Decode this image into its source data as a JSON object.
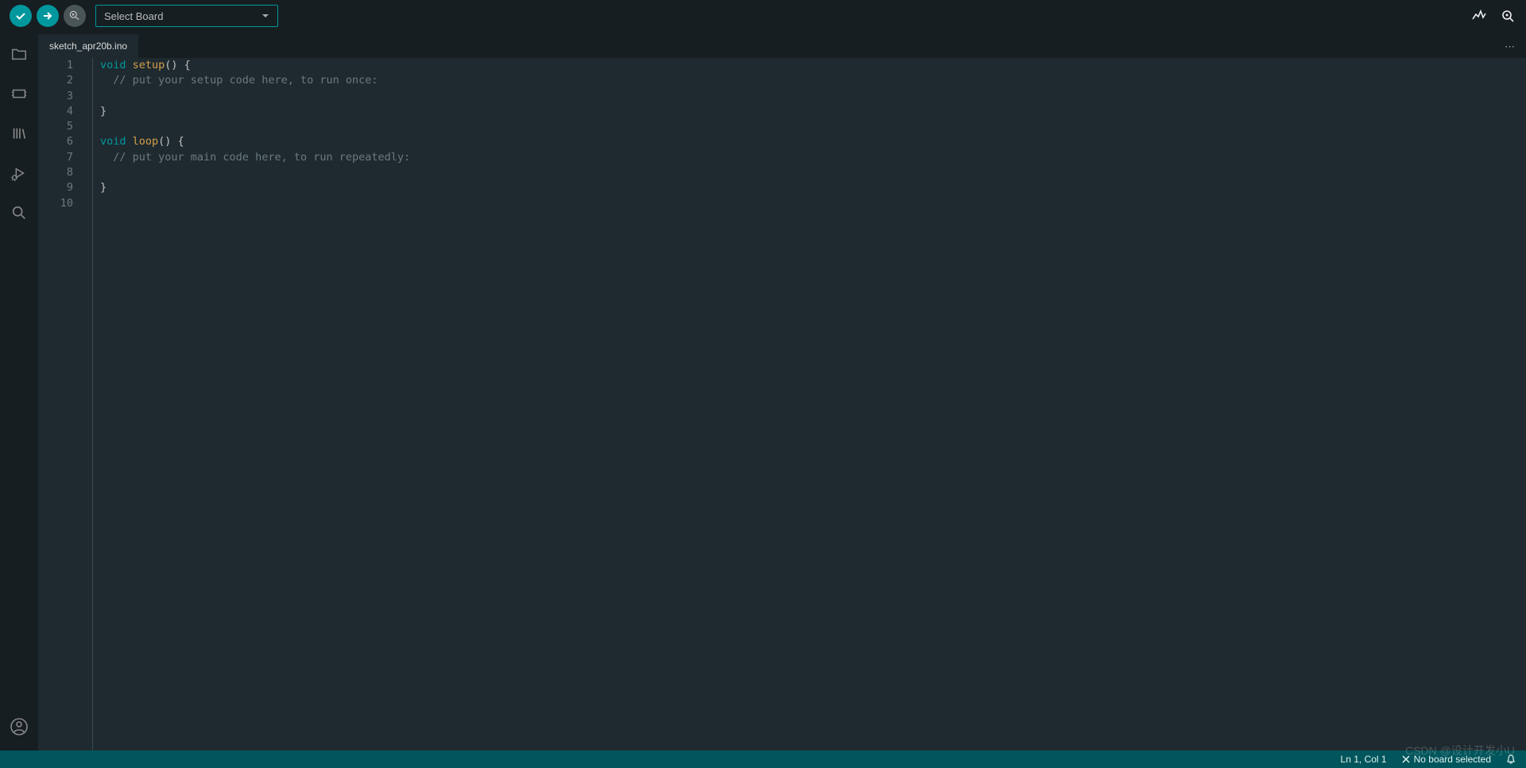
{
  "toolbar": {
    "board_select_label": "Select Board"
  },
  "tab": {
    "name": "sketch_apr20b.ino"
  },
  "code": {
    "lines": [
      {
        "n": "1",
        "segments": [
          {
            "t": "void",
            "c": "kw"
          },
          {
            "t": " ",
            "c": ""
          },
          {
            "t": "setup",
            "c": "fn"
          },
          {
            "t": "() {",
            "c": ""
          }
        ]
      },
      {
        "n": "2",
        "segments": [
          {
            "t": "  // put your setup code here, to run once:",
            "c": "cm"
          }
        ]
      },
      {
        "n": "3",
        "segments": []
      },
      {
        "n": "4",
        "segments": [
          {
            "t": "}",
            "c": ""
          }
        ]
      },
      {
        "n": "5",
        "segments": []
      },
      {
        "n": "6",
        "segments": [
          {
            "t": "void",
            "c": "kw"
          },
          {
            "t": " ",
            "c": ""
          },
          {
            "t": "loop",
            "c": "fn"
          },
          {
            "t": "() {",
            "c": ""
          }
        ]
      },
      {
        "n": "7",
        "segments": [
          {
            "t": "  // put your main code here, to run repeatedly:",
            "c": "cm"
          }
        ]
      },
      {
        "n": "8",
        "segments": []
      },
      {
        "n": "9",
        "segments": [
          {
            "t": "}",
            "c": ""
          }
        ]
      },
      {
        "n": "10",
        "segments": []
      }
    ]
  },
  "status": {
    "cursor": "Ln 1, Col 1",
    "board": "No board selected"
  },
  "watermark": "CSDN @设计开发小U"
}
